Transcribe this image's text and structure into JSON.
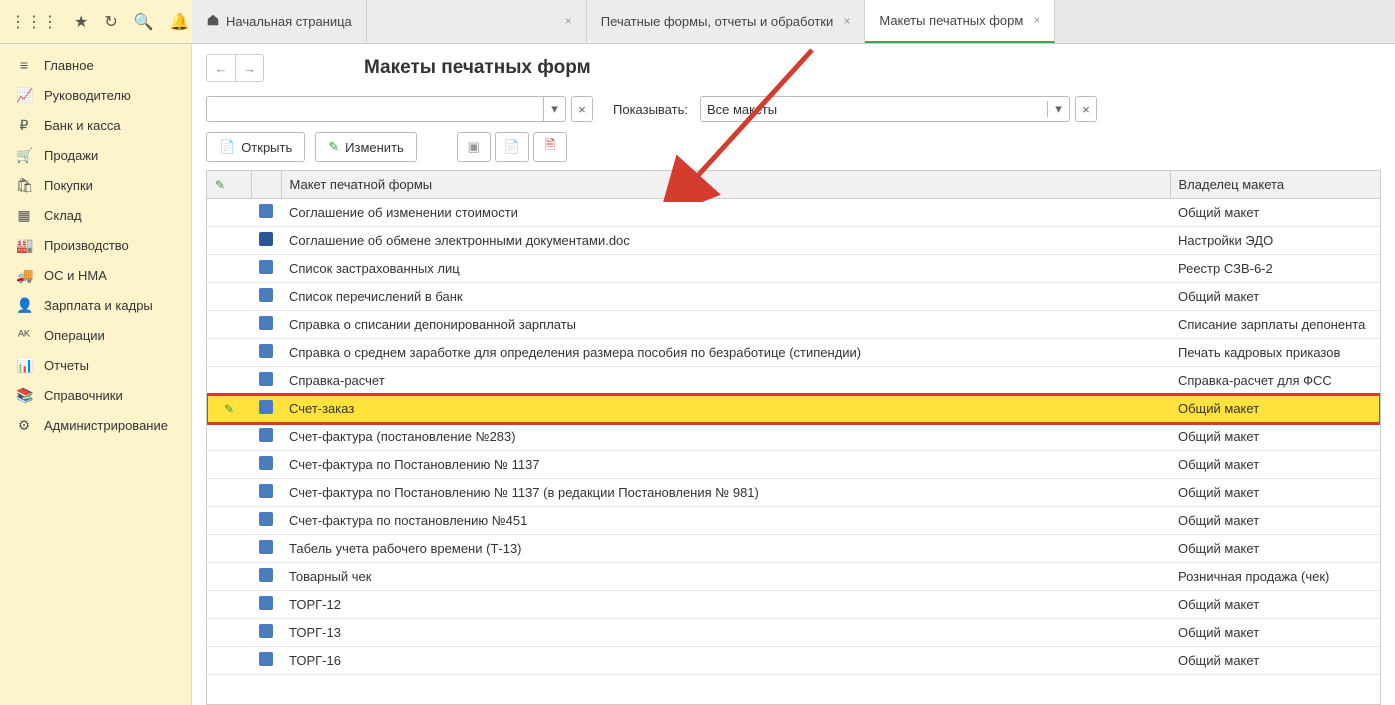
{
  "tabs": {
    "home": "Начальная страница",
    "t1": "",
    "t2": "Печатные формы, отчеты и обработки",
    "t3": "Макеты печатных форм"
  },
  "sidebar": {
    "items": [
      {
        "icon": "menu",
        "label": "Главное"
      },
      {
        "icon": "chart",
        "label": "Руководителю"
      },
      {
        "icon": "ruble",
        "label": "Банк и касса"
      },
      {
        "icon": "cart",
        "label": "Продажи"
      },
      {
        "icon": "cart2",
        "label": "Покупки"
      },
      {
        "icon": "boxes",
        "label": "Склад"
      },
      {
        "icon": "factory",
        "label": "Производство"
      },
      {
        "icon": "truck",
        "label": "ОС и НМА"
      },
      {
        "icon": "person",
        "label": "Зарплата и кадры"
      },
      {
        "icon": "ops",
        "label": "Операции"
      },
      {
        "icon": "report",
        "label": "Отчеты"
      },
      {
        "icon": "book",
        "label": "Справочники"
      },
      {
        "icon": "gear",
        "label": "Администрирование"
      }
    ]
  },
  "page": {
    "title": "Макеты печатных форм",
    "filter_label": "Показывать:",
    "filter_value": "Все макеты",
    "btn_open": "Открыть",
    "btn_edit": "Изменить"
  },
  "table": {
    "col_name": "Макет печатной формы",
    "col_owner": "Владелец макета",
    "rows": [
      {
        "name": "Соглашение об изменении стоимости",
        "owner": "Общий макет",
        "t": "d"
      },
      {
        "name": "Соглашение об обмене электронными документами.doc",
        "owner": "Настройки ЭДО",
        "t": "w"
      },
      {
        "name": "Список застрахованных лиц",
        "owner": "Реестр СЗВ-6-2",
        "t": "d"
      },
      {
        "name": "Список перечислений в банк",
        "owner": "Общий макет",
        "t": "d"
      },
      {
        "name": "Справка о списании депонированной зарплаты",
        "owner": "Списание зарплаты депонента",
        "t": "d"
      },
      {
        "name": "Справка о среднем заработке для определения размера пособия по безработице (стипендии)",
        "owner": "Печать кадровых приказов",
        "t": "d"
      },
      {
        "name": "Справка-расчет",
        "owner": "Справка-расчет для ФСС",
        "t": "d"
      },
      {
        "name": "Счет-заказ",
        "owner": "Общий макет",
        "t": "d",
        "hl": true
      },
      {
        "name": "Счет-фактура (постановление №283)",
        "owner": "Общий макет",
        "t": "d"
      },
      {
        "name": "Счет-фактура по Постановлению № 1137",
        "owner": "Общий макет",
        "t": "d"
      },
      {
        "name": "Счет-фактура по Постановлению № 1137 (в редакции Постановления № 981)",
        "owner": "Общий макет",
        "t": "d"
      },
      {
        "name": "Счет-фактура по постановлению №451",
        "owner": "Общий макет",
        "t": "d"
      },
      {
        "name": "Табель учета рабочего времени (Т-13)",
        "owner": "Общий макет",
        "t": "d"
      },
      {
        "name": "Товарный чек",
        "owner": "Розничная продажа (чек)",
        "t": "d"
      },
      {
        "name": "ТОРГ-12",
        "owner": "Общий макет",
        "t": "d"
      },
      {
        "name": "ТОРГ-13",
        "owner": "Общий макет",
        "t": "d"
      },
      {
        "name": "ТОРГ-16",
        "owner": "Общий макет",
        "t": "d"
      }
    ]
  }
}
